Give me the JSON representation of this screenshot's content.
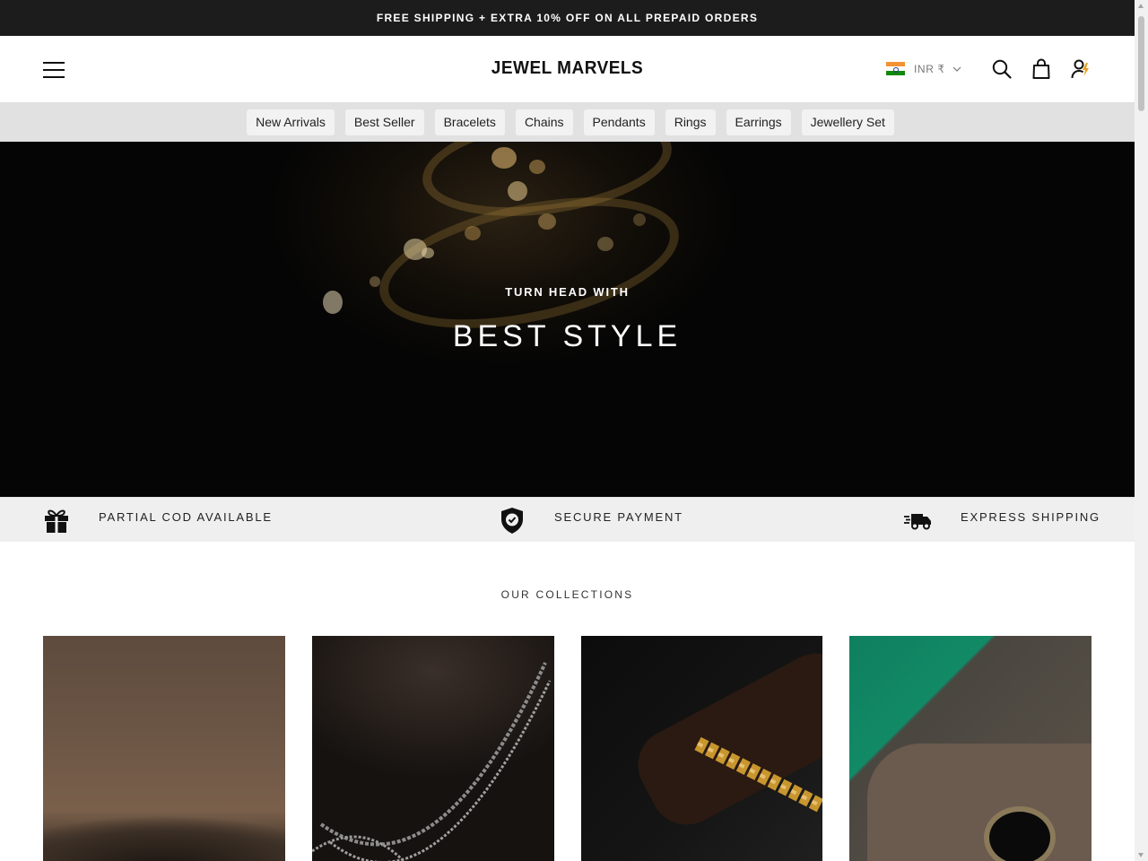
{
  "announcement": {
    "text": "FREE SHIPPING + EXTRA 10% OFF ON ALL PREPAID ORDERS"
  },
  "header": {
    "logo": "JEWEL MARVELS",
    "currency": "INR ₹",
    "icons": [
      "menu-icon",
      "search-icon",
      "bag-icon",
      "account-icon"
    ]
  },
  "categories": [
    "New Arrivals",
    "Best Seller",
    "Bracelets",
    "Chains",
    "Pendants",
    "Rings",
    "Earrings",
    "Jewellery Set"
  ],
  "hero": {
    "subtitle": "TURN HEAD WITH",
    "title": "BEST STYLE"
  },
  "features": [
    {
      "icon": "gift-icon",
      "label": "PARTIAL COD AVAILABLE"
    },
    {
      "icon": "shield-check-icon",
      "label": "SECURE PAYMENT"
    },
    {
      "icon": "delivery-truck-icon",
      "label": "EXPRESS SHIPPING"
    }
  ],
  "collections": {
    "title": "OUR COLLECTIONS"
  },
  "colors": {
    "announcement_bg": "#1c1c1c",
    "category_bar_bg": "#e1e1e1",
    "feature_bar_bg": "#efefef",
    "accent_gold": "#c8962e"
  }
}
